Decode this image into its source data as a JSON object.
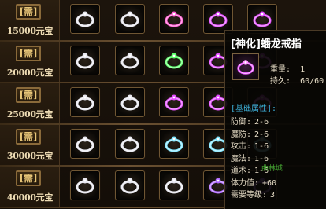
{
  "shop": {
    "rows": [
      {
        "need": "[需]",
        "price": "15000元宝",
        "rings": [
          "white",
          "white",
          "pink",
          "magenta",
          "magenta"
        ]
      },
      {
        "need": "[需]",
        "price": "20000元宝",
        "rings": [
          "white",
          "white",
          "green",
          "magenta",
          "magenta"
        ]
      },
      {
        "need": "[需]",
        "price": "25000元宝",
        "rings": [
          "white",
          "white",
          "magenta",
          "magenta",
          "magenta"
        ]
      },
      {
        "need": "[需]",
        "price": "30000元宝",
        "rings": [
          "white",
          "white",
          "cyan",
          "cyan",
          "cyan"
        ]
      },
      {
        "need": "[需]",
        "price": "40000元宝",
        "rings": [
          "white",
          "white",
          "white",
          "purple",
          "purple"
        ]
      }
    ]
  },
  "tooltip": {
    "title": "[神化]蟠龙戒指",
    "weight_label": "重量:",
    "weight_value": "1",
    "durability_label": "持久:",
    "durability_value": "60/60",
    "section": "[基础属性]:",
    "stats": [
      {
        "label": "防御:",
        "value": "2-6"
      },
      {
        "label": "魔防:",
        "value": "2-6"
      },
      {
        "label": "攻击:",
        "value": "1-6"
      },
      {
        "label": "魔法:",
        "value": "1-6"
      },
      {
        "label": "道术:",
        "value": "1-6"
      },
      {
        "label": "体力值:",
        "value": "+60"
      },
      {
        "label": "需要等级:",
        "value": "3"
      }
    ]
  },
  "colors": {
    "white": "#e8e8f0",
    "pink": "#ff5ad2",
    "magenta": "#e44cff",
    "green": "#5cff6a",
    "cyan": "#7fe6ff",
    "purple": "#b06bff"
  },
  "background_text": "曲林城"
}
